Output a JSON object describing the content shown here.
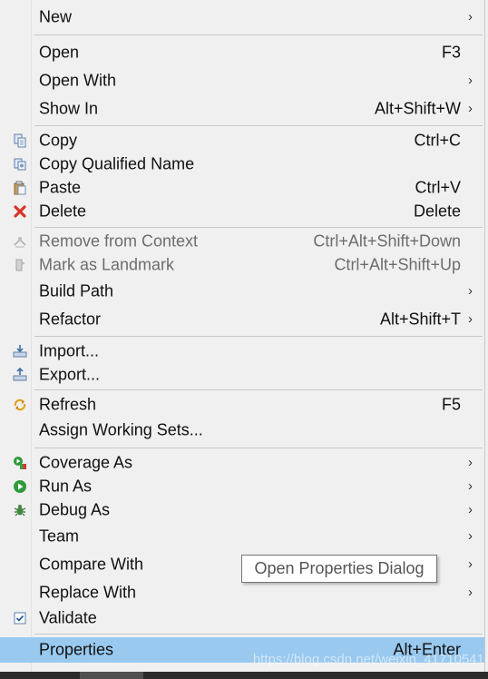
{
  "menu": {
    "items": [
      {
        "label": "New",
        "shortcut": "",
        "submenu": true,
        "icon": "",
        "disabled": false
      },
      {
        "label": "Open",
        "shortcut": "F3",
        "submenu": false,
        "icon": "",
        "disabled": false
      },
      {
        "label": "Open With",
        "shortcut": "",
        "submenu": true,
        "icon": "",
        "disabled": false
      },
      {
        "label": "Show In",
        "shortcut": "Alt+Shift+W",
        "submenu": true,
        "icon": "",
        "disabled": false
      },
      {
        "label": "Copy",
        "shortcut": "Ctrl+C",
        "submenu": false,
        "icon": "copy-icon",
        "disabled": false
      },
      {
        "label": "Copy Qualified Name",
        "shortcut": "",
        "submenu": false,
        "icon": "copy-qualified-name-icon",
        "disabled": false
      },
      {
        "label": "Paste",
        "shortcut": "Ctrl+V",
        "submenu": false,
        "icon": "paste-icon",
        "disabled": false
      },
      {
        "label": "Delete",
        "shortcut": "Delete",
        "submenu": false,
        "icon": "delete-icon",
        "disabled": false
      },
      {
        "label": "Remove from Context",
        "shortcut": "Ctrl+Alt+Shift+Down",
        "submenu": false,
        "icon": "remove-context-icon",
        "disabled": true
      },
      {
        "label": "Mark as Landmark",
        "shortcut": "Ctrl+Alt+Shift+Up",
        "submenu": false,
        "icon": "landmark-icon",
        "disabled": true
      },
      {
        "label": "Build Path",
        "shortcut": "",
        "submenu": true,
        "icon": "",
        "disabled": false
      },
      {
        "label": "Refactor",
        "shortcut": "Alt+Shift+T",
        "submenu": true,
        "icon": "",
        "disabled": false
      },
      {
        "label": "Import...",
        "shortcut": "",
        "submenu": false,
        "icon": "import-icon",
        "disabled": false
      },
      {
        "label": "Export...",
        "shortcut": "",
        "submenu": false,
        "icon": "export-icon",
        "disabled": false
      },
      {
        "label": "Refresh",
        "shortcut": "F5",
        "submenu": false,
        "icon": "refresh-icon",
        "disabled": false
      },
      {
        "label": "Assign Working Sets...",
        "shortcut": "",
        "submenu": false,
        "icon": "",
        "disabled": false
      },
      {
        "label": "Coverage As",
        "shortcut": "",
        "submenu": true,
        "icon": "coverage-icon",
        "disabled": false
      },
      {
        "label": "Run As",
        "shortcut": "",
        "submenu": true,
        "icon": "run-icon",
        "disabled": false
      },
      {
        "label": "Debug As",
        "shortcut": "",
        "submenu": true,
        "icon": "debug-icon",
        "disabled": false
      },
      {
        "label": "Team",
        "shortcut": "",
        "submenu": true,
        "icon": "",
        "disabled": false
      },
      {
        "label": "Compare With",
        "shortcut": "",
        "submenu": true,
        "icon": "",
        "disabled": false
      },
      {
        "label": "Replace With",
        "shortcut": "",
        "submenu": true,
        "icon": "",
        "disabled": false
      },
      {
        "label": "Validate",
        "shortcut": "",
        "submenu": false,
        "icon": "validate-icon",
        "disabled": false
      },
      {
        "label": "Properties",
        "shortcut": "Alt+Enter",
        "submenu": false,
        "icon": "",
        "disabled": false,
        "selected": true
      }
    ],
    "submenu_glyph": "›"
  },
  "tooltip": {
    "text": "Open Properties Dialog"
  },
  "watermark": {
    "text": "https://blog.csdn.net/weixin_41710541"
  },
  "colors": {
    "menu_bg": "#f0f0f0",
    "selection": "#99c9ef",
    "separator": "#c8c8c8",
    "disabled_text": "#6d6d6d"
  }
}
